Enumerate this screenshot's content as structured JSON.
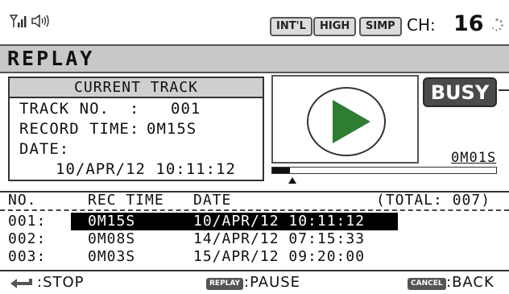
{
  "status": {
    "modes": [
      "INT'L",
      "HIGH",
      "SIMP"
    ],
    "channel_label": "CH:",
    "channel_value": "16"
  },
  "title": "REPLAY",
  "current_track": {
    "header": "CURRENT TRACK",
    "track_no_label": "TRACK NO.  :",
    "track_no_value": "001",
    "record_time_label": "RECORD TIME:",
    "record_time_value": "0M15S",
    "date_label": "DATE:",
    "date_value": "10/APR/12 10:11:12"
  },
  "player": {
    "busy_label": "BUSY",
    "elapsed": "0M01S",
    "progress": 0.08,
    "play_icon": "play-icon"
  },
  "track_list": {
    "headers": {
      "no": "NO.",
      "rec_time": "REC TIME",
      "date": "DATE",
      "total": "(TOTAL: 007)"
    },
    "rows": [
      {
        "no": "001:",
        "rec_time": "0M15S",
        "date": "10/APR/12 10:11:12",
        "selected": true
      },
      {
        "no": "002:",
        "rec_time": "0M08S",
        "date": "14/APR/12 07:15:33",
        "selected": false
      },
      {
        "no": "003:",
        "rec_time": "0M03S",
        "date": "15/APR/12 09:20:00",
        "selected": false
      }
    ]
  },
  "footer": {
    "stop_label": ":STOP",
    "replay_key": "REPLAY",
    "pause_label": ":PAUSE",
    "cancel_key": "CANCEL",
    "back_label": ":BACK"
  },
  "colors": {
    "play": "#2e7d32",
    "title_band": "#c8c8c8",
    "busy": "#4a4a4a"
  }
}
